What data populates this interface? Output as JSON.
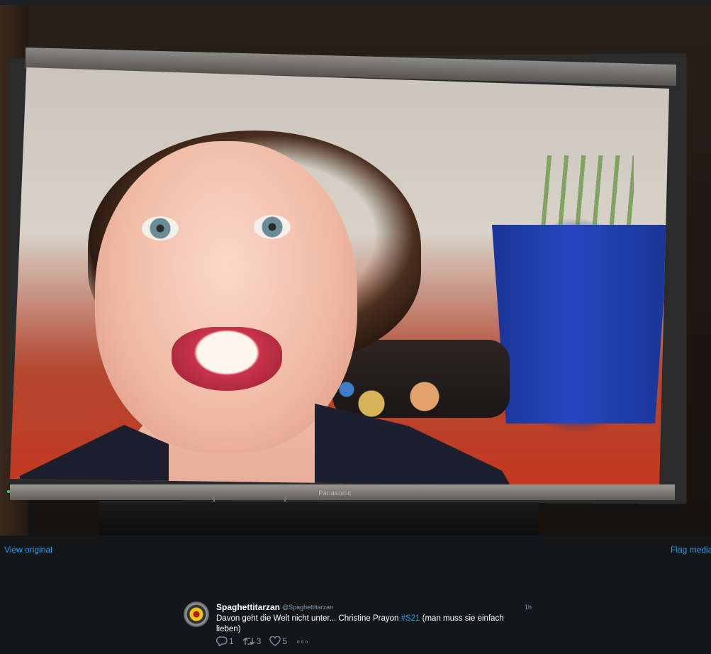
{
  "media": {
    "tv_brand": "Panasonic",
    "view_original_label": "View original",
    "flag_media_label": "Flag media"
  },
  "tweet": {
    "author_name": "Spaghettitarzan",
    "author_handle": "@Spaghettitarzan",
    "time": "1h",
    "text_before": "Davon geht die Welt nicht unter... Christine Prayon ",
    "hashtag": "#S21",
    "text_after": " (man muss sie einfach lieben)",
    "reply_count": "1",
    "retweet_count": "3",
    "like_count": "5",
    "more_label": "∘∘∘"
  },
  "icons": {
    "reply": "reply-icon",
    "retweet": "retweet-icon",
    "like": "heart-icon",
    "more": "more-icon"
  },
  "colors": {
    "background": "#14171a",
    "link": "#1da1f2",
    "muted": "#8899a6"
  }
}
